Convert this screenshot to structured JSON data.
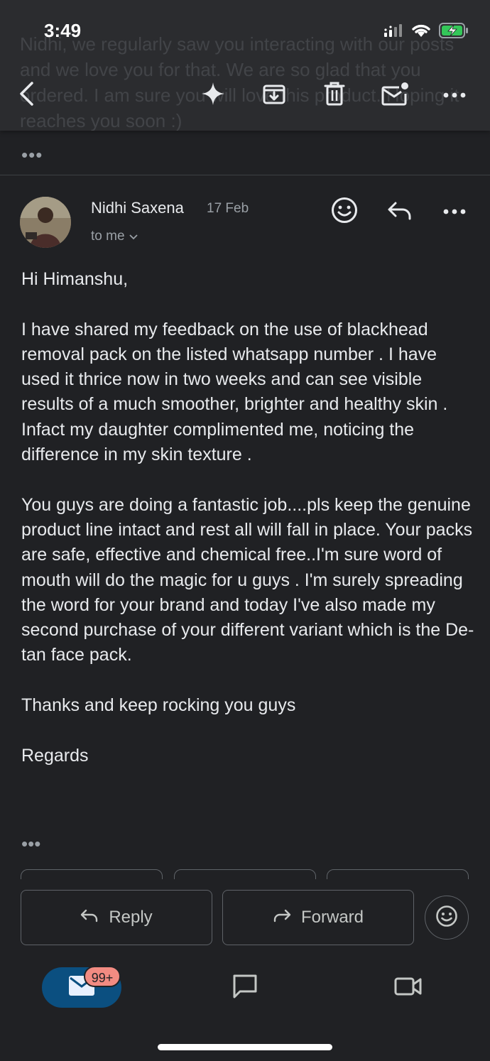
{
  "status_bar": {
    "time": "3:49"
  },
  "background_preview": {
    "text": "Nidhi, we regularly saw you interacting with our posts and we love you for that. We are so glad that you ordered. I am sure you will love this product. Hoping it reaches you soon :)"
  },
  "toolbar": {
    "icons": [
      "back-arrow-icon",
      "sparkle-icon",
      "archive-icon",
      "delete-icon",
      "mark-unread-icon",
      "more-icon"
    ]
  },
  "collapsed_thread": {
    "dots": "•••"
  },
  "message": {
    "sender": "Nidhi Saxena",
    "date": "17 Feb",
    "recipient": "to me",
    "paragraphs": [
      "Hi Himanshu,",
      "I have shared my feedback on the use of blackhead removal pack on the listed whatsapp number . I have used it thrice now in two weeks and can see visible results of a much smoother, brighter and healthy skin . Infact my daughter complimented me, noticing the difference in my skin texture .",
      "You guys are doing a fantastic job....pls keep the genuine product line intact and rest all will fall in place. Your packs are safe, effective and chemical free..I'm  sure word of mouth will do the magic for u guys . I'm surely spreading the word for your brand and today I've also made my second purchase of your different variant which is the De-tan face pack.",
      "Thanks and keep rocking you guys",
      "Regards"
    ],
    "more_dots": "•••"
  },
  "actions": {
    "reply_label": "Reply",
    "forward_label": "Forward"
  },
  "bottom_nav": {
    "mail_badge": "99+"
  },
  "colors": {
    "background": "#202124",
    "toolbar": "#2b2c2f",
    "badge": "#f28b82",
    "mail_pill": "#0b4f80",
    "battery_charging": "#34c759"
  }
}
